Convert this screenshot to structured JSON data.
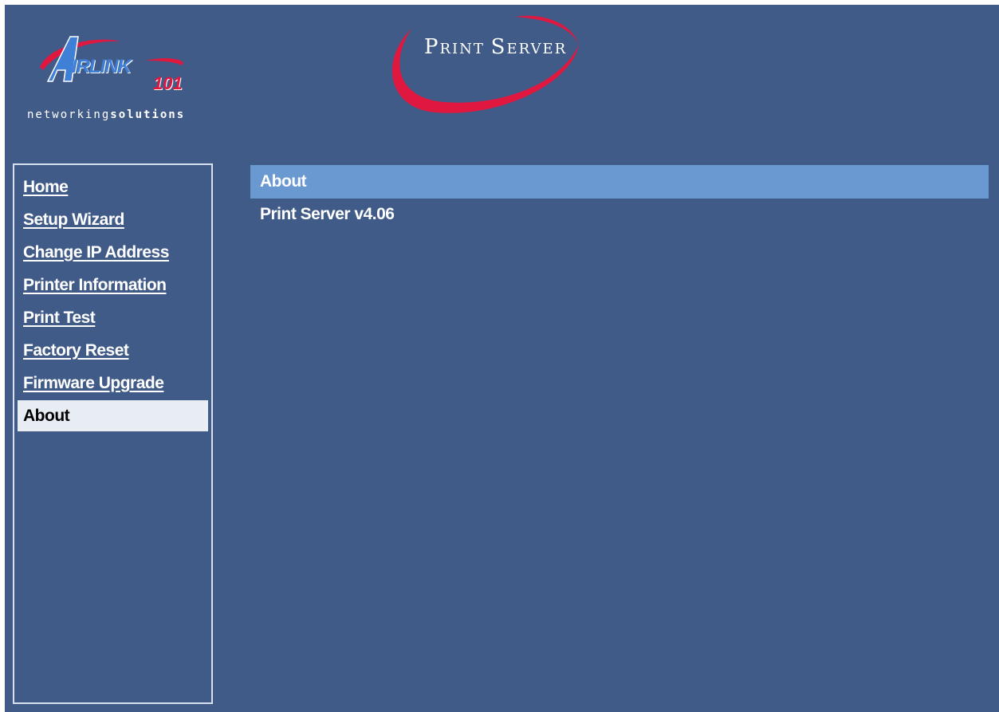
{
  "brand": {
    "logo_wordmark": "IRLINK",
    "logo_letter": "A",
    "logo_number": "101",
    "tagline_light": "networking",
    "tagline_bold": "solutions",
    "product_title_first": "P",
    "product_title_first_rest": "RINT",
    "product_title_second": "S",
    "product_title_second_rest": "ERVER",
    "accent_red": "#e0173f",
    "accent_blue": "#3f7fd6",
    "background": "#415b88"
  },
  "sidebar": {
    "items": [
      {
        "label": "Home"
      },
      {
        "label": "Setup Wizard"
      },
      {
        "label": "Change IP Address"
      },
      {
        "label": "Printer Information"
      },
      {
        "label": "Print Test"
      },
      {
        "label": "Factory Reset"
      },
      {
        "label": "Firmware Upgrade"
      },
      {
        "label": "About",
        "active": true
      }
    ]
  },
  "main": {
    "section_title": "About",
    "version_text": "Print Server v4.06"
  }
}
